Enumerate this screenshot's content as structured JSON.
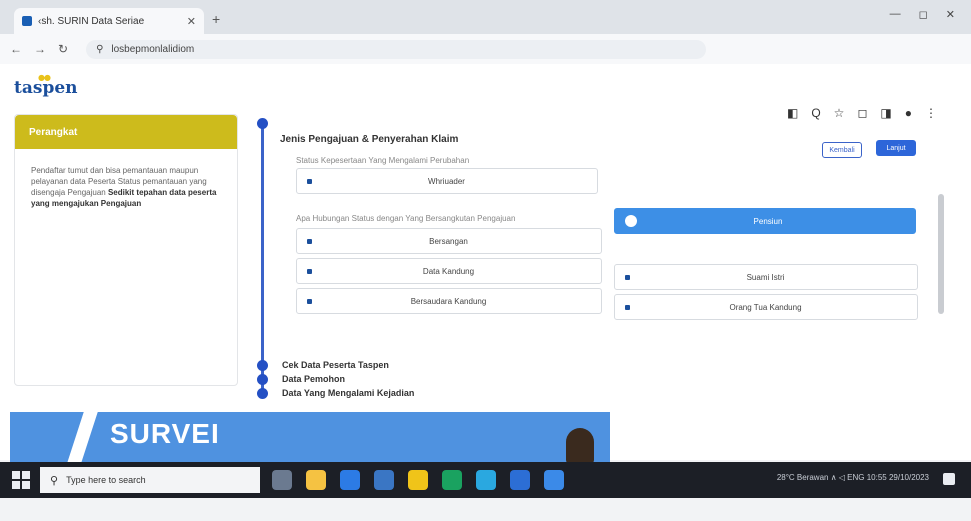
{
  "browser": {
    "tab_title": "‹sh. SURIN Data Seriae",
    "new_tab": "+",
    "url": "losbepmonlalidiom",
    "window_controls": [
      "—",
      "◻",
      "✕"
    ],
    "extension_icons": [
      "◧",
      "Q",
      "☆",
      "◻",
      "◨",
      "●",
      "⋮"
    ]
  },
  "page": {
    "logo": "taspen",
    "side_card": {
      "header": "Perangkat",
      "body_text": "Pendaftar tumut dan bisa pemantauan maupun pelayanan data Peserta Status pemantauan yang disengaja Pengajuan ",
      "body_bold": "Sedikit tepahan data peserta yang mengajukan Pengajuan"
    },
    "section_title": "Jenis Pengajuan & Penyerahan Klaim",
    "buttons": {
      "back": "Kembali",
      "next": "Lanjut"
    },
    "group1_label": "Status Kepesertaan Yang Mengalami Perubahan",
    "group1_left": "Whriuader",
    "group1_right": "Pensiun",
    "group2_label": "Apa Hubungan Status dengan Yang Bersangkutan Pengajuan",
    "group2_left": [
      "Bersangan",
      "Data Kandung",
      "Bersaudara Kandung"
    ],
    "group2_right": [
      "Suami Istri",
      "Orang Tua Kandung"
    ],
    "steps": [
      "Cek Data Peserta Taspen",
      "Data Pemohon",
      "Data Yang Mengalami Kejadian"
    ]
  },
  "banner": {
    "text": "SURVEI"
  },
  "taskbar": {
    "search_placeholder": "Type here to search",
    "tray_text": "28°C Berawan   ∧  ◁  ENG   10:55   29/10/2023",
    "icon_colors": [
      "#6b7a90",
      "#f5c242",
      "#2c7be5",
      "#3a76c4",
      "#f0c419",
      "#1aa260",
      "#2aa8e0",
      "#2c6ed5",
      "#3b8ae8"
    ]
  }
}
